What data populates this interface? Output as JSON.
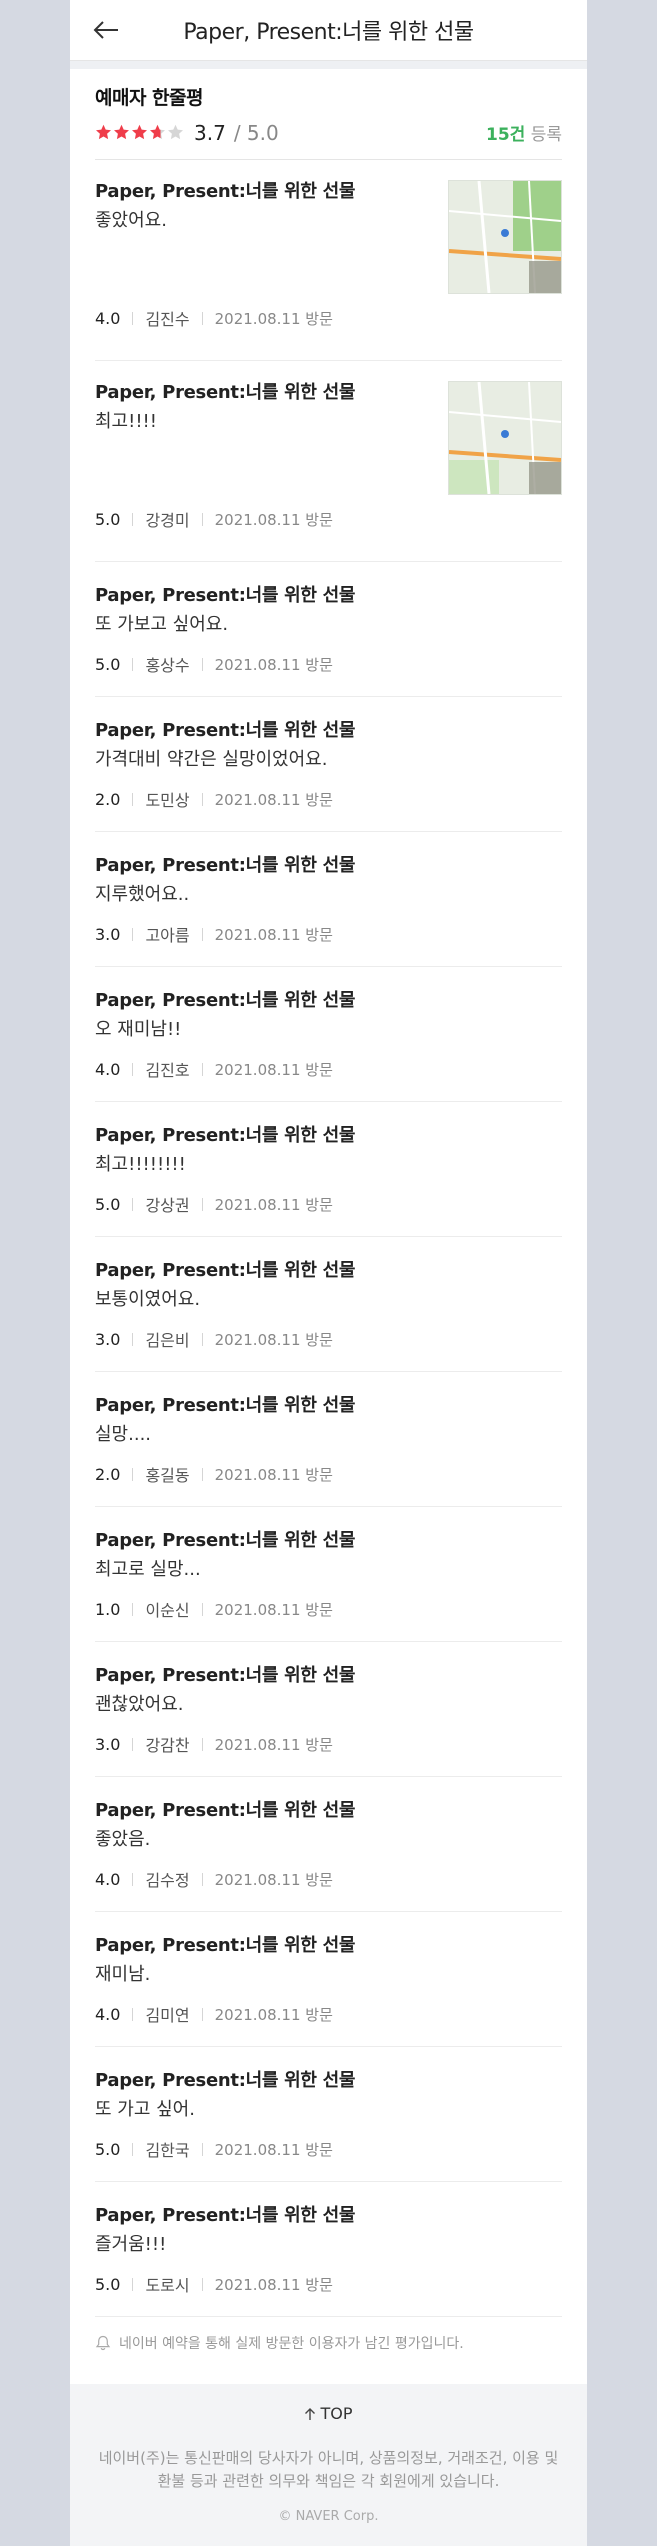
{
  "header": {
    "title": "Paper, Present:너를 위한 선물"
  },
  "summary": {
    "title": "예매자 한줄평",
    "score": "3.7",
    "outof": "/ 5.0",
    "rating": 3.7,
    "count_num": "15건",
    "count_suffix": " 등록",
    "star_color": "#ef3d4a"
  },
  "reviews": [
    {
      "title": "Paper, Present:너를 위한 선물",
      "comment": "좋았어요.",
      "score": "4.0",
      "name": "김진수",
      "date": "2021.08.11 방문",
      "thumb": true
    },
    {
      "title": "Paper, Present:너를 위한 선물",
      "comment": "최고!!!!",
      "score": "5.0",
      "name": "강경미",
      "date": "2021.08.11 방문",
      "thumb": true
    },
    {
      "title": "Paper, Present:너를 위한 선물",
      "comment": "또 가보고 싶어요.",
      "score": "5.0",
      "name": "홍상수",
      "date": "2021.08.11 방문"
    },
    {
      "title": "Paper, Present:너를 위한 선물",
      "comment": "가격대비 약간은 실망이었어요.",
      "score": "2.0",
      "name": "도민상",
      "date": "2021.08.11 방문"
    },
    {
      "title": "Paper, Present:너를 위한 선물",
      "comment": "지루했어요..",
      "score": "3.0",
      "name": "고아름",
      "date": "2021.08.11 방문"
    },
    {
      "title": "Paper, Present:너를 위한 선물",
      "comment": "오 재미남!!",
      "score": "4.0",
      "name": "김진호",
      "date": "2021.08.11 방문"
    },
    {
      "title": "Paper, Present:너를 위한 선물",
      "comment": "최고!!!!!!!!",
      "score": "5.0",
      "name": "강상권",
      "date": "2021.08.11 방문"
    },
    {
      "title": "Paper, Present:너를 위한 선물",
      "comment": "보통이였어요.",
      "score": "3.0",
      "name": "김은비",
      "date": "2021.08.11 방문"
    },
    {
      "title": "Paper, Present:너를 위한 선물",
      "comment": "실망....",
      "score": "2.0",
      "name": "홍길동",
      "date": "2021.08.11 방문"
    },
    {
      "title": "Paper, Present:너를 위한 선물",
      "comment": "최고로 실망...",
      "score": "1.0",
      "name": "이순신",
      "date": "2021.08.11 방문"
    },
    {
      "title": "Paper, Present:너를 위한 선물",
      "comment": "괜찮았어요.",
      "score": "3.0",
      "name": "강감찬",
      "date": "2021.08.11 방문"
    },
    {
      "title": "Paper, Present:너를 위한 선물",
      "comment": "좋았음.",
      "score": "4.0",
      "name": "김수정",
      "date": "2021.08.11 방문"
    },
    {
      "title": "Paper, Present:너를 위한 선물",
      "comment": "재미남.",
      "score": "4.0",
      "name": "김미연",
      "date": "2021.08.11 방문"
    },
    {
      "title": "Paper, Present:너를 위한 선물",
      "comment": "또 가고 싶어.",
      "score": "5.0",
      "name": "김한국",
      "date": "2021.08.11 방문"
    },
    {
      "title": "Paper, Present:너를 위한 선물",
      "comment": "즐거움!!!",
      "score": "5.0",
      "name": "도로시",
      "date": "2021.08.11 방문"
    }
  ],
  "notice": "네이버 예약을 통해 실제 방문한 이용자가 남긴 평가입니다.",
  "footer": {
    "top_label": "TOP",
    "note": "네이버(주)는 통신판매의 당사자가 아니며, 상품의정보, 거래조건, 이용 및 환불 등과 관련한 의무와 책임은 각 회원에게 있습니다.",
    "copyright": "© NAVER Corp."
  }
}
